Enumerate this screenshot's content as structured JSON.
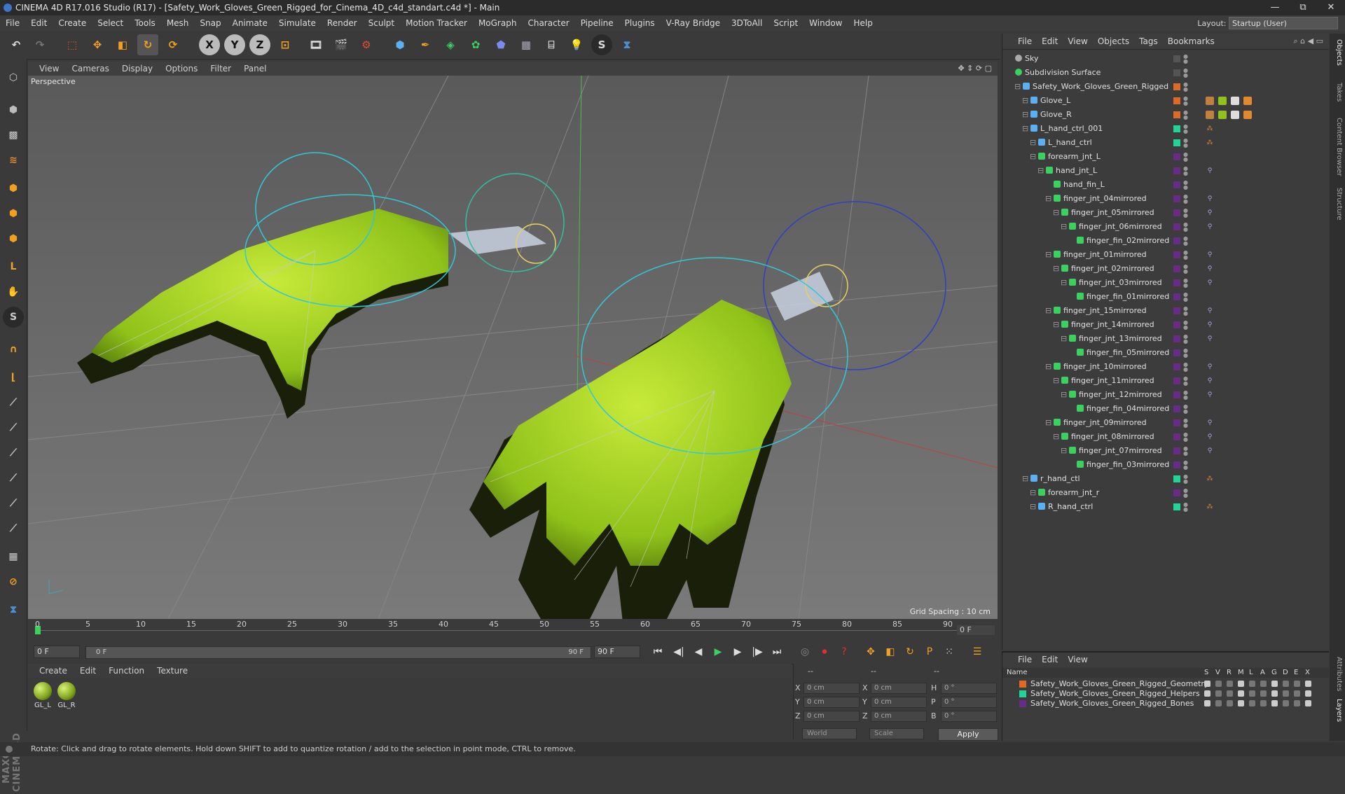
{
  "window": {
    "title": "CINEMA 4D R17.016 Studio (R17) - [Safety_Work_Gloves_Green_Rigged_for_Cinema_4D_c4d_standart.c4d *] - Main",
    "minimize": "—",
    "restore": "⧉",
    "close": "✕"
  },
  "menubar": {
    "items": [
      "File",
      "Edit",
      "Create",
      "Select",
      "Tools",
      "Mesh",
      "Snap",
      "Animate",
      "Simulate",
      "Render",
      "Sculpt",
      "Motion Tracker",
      "MoGraph",
      "Character",
      "Pipeline",
      "Plugins",
      "V-Ray Bridge",
      "3DToAll",
      "Script",
      "Window",
      "Help"
    ],
    "layout_label": "Layout:",
    "layout_value": "Startup (User)"
  },
  "toolbar": {
    "x_axis": "X",
    "y_axis": "Y",
    "z_axis": "Z"
  },
  "viewport": {
    "menu": [
      "View",
      "Cameras",
      "Display",
      "Options",
      "Filter",
      "Panel"
    ],
    "label": "Perspective",
    "grid_spacing": "Grid Spacing : 10 cm"
  },
  "timeline": {
    "ticks": [
      "0",
      "5",
      "10",
      "15",
      "20",
      "25",
      "30",
      "35",
      "40",
      "45",
      "50",
      "55",
      "60",
      "65",
      "70",
      "75",
      "80",
      "85",
      "90"
    ],
    "frame_end_display": "0 F",
    "current_frame": "0 F",
    "range_start": "0 F",
    "range_end": "90 F",
    "range_end_field": "90 F"
  },
  "materials": {
    "menu": [
      "Create",
      "Edit",
      "Function",
      "Texture"
    ],
    "items": [
      {
        "label": "GL_L"
      },
      {
        "label": "GL_R"
      }
    ]
  },
  "coords": {
    "header_left": "--",
    "header_mid": "--",
    "header_right": "--",
    "rows": [
      {
        "axis": "X",
        "pos": "0 cm",
        "axis2": "X",
        "size": "0 cm",
        "rot_label": "H",
        "rot": "0 °"
      },
      {
        "axis": "Y",
        "pos": "0 cm",
        "axis2": "Y",
        "size": "0 cm",
        "rot_label": "P",
        "rot": "0 °"
      },
      {
        "axis": "Z",
        "pos": "0 cm",
        "axis2": "Z",
        "size": "0 cm",
        "rot_label": "B",
        "rot": "0 °"
      }
    ],
    "mode": "World",
    "scale": "Scale",
    "apply": "Apply"
  },
  "objects": {
    "menu": [
      "File",
      "Edit",
      "View",
      "Objects",
      "Tags",
      "Bookmarks"
    ],
    "rows": [
      {
        "name": "Sky",
        "indent": 0,
        "color": "",
        "tags": ""
      },
      {
        "name": "Subdivision Surface",
        "indent": 0,
        "color": "",
        "tags": ""
      },
      {
        "name": "Safety_Work_Gloves_Green_Rigged",
        "indent": 1,
        "color": "#e06a24",
        "tags": ""
      },
      {
        "name": "Glove_L",
        "indent": 2,
        "color": "#e06a24",
        "tags": "mat"
      },
      {
        "name": "Glove_R",
        "indent": 2,
        "color": "#e06a24",
        "tags": "mat"
      },
      {
        "name": "L_hand_ctrl_001",
        "indent": 2,
        "color": "#22d39a",
        "tags": "ctrl"
      },
      {
        "name": "L_hand_ctrl",
        "indent": 3,
        "color": "#22d39a",
        "tags": "ctrl"
      },
      {
        "name": "forearm_jnt_L",
        "indent": 3,
        "color": "#6a2a8a",
        "tags": ""
      },
      {
        "name": "hand_jnt_L",
        "indent": 4,
        "color": "#6a2a8a",
        "tags": "ik"
      },
      {
        "name": "hand_fin_L",
        "indent": 5,
        "color": "#6a2a8a",
        "tags": ""
      },
      {
        "name": "finger_jnt_04mirrored",
        "indent": 5,
        "color": "#6a2a8a",
        "tags": "ik"
      },
      {
        "name": "finger_jnt_05mirrored",
        "indent": 6,
        "color": "#6a2a8a",
        "tags": "ik"
      },
      {
        "name": "finger_jnt_06mirrored",
        "indent": 7,
        "color": "#6a2a8a",
        "tags": "ik"
      },
      {
        "name": "finger_fin_02mirrored",
        "indent": 8,
        "color": "#6a2a8a",
        "tags": ""
      },
      {
        "name": "finger_jnt_01mirrored",
        "indent": 5,
        "color": "#6a2a8a",
        "tags": "ik"
      },
      {
        "name": "finger_jnt_02mirrored",
        "indent": 6,
        "color": "#6a2a8a",
        "tags": "ik"
      },
      {
        "name": "finger_jnt_03mirrored",
        "indent": 7,
        "color": "#6a2a8a",
        "tags": "ik"
      },
      {
        "name": "finger_fin_01mirrored",
        "indent": 8,
        "color": "#6a2a8a",
        "tags": ""
      },
      {
        "name": "finger_jnt_15mirrored",
        "indent": 5,
        "color": "#6a2a8a",
        "tags": "ik"
      },
      {
        "name": "finger_jnt_14mirrored",
        "indent": 6,
        "color": "#6a2a8a",
        "tags": "ik"
      },
      {
        "name": "finger_jnt_13mirrored",
        "indent": 7,
        "color": "#6a2a8a",
        "tags": "ik"
      },
      {
        "name": "finger_fin_05mirrored",
        "indent": 8,
        "color": "#6a2a8a",
        "tags": ""
      },
      {
        "name": "finger_jnt_10mirrored",
        "indent": 5,
        "color": "#6a2a8a",
        "tags": "ik"
      },
      {
        "name": "finger_jnt_11mirrored",
        "indent": 6,
        "color": "#6a2a8a",
        "tags": "ik"
      },
      {
        "name": "finger_jnt_12mirrored",
        "indent": 7,
        "color": "#6a2a8a",
        "tags": "ik"
      },
      {
        "name": "finger_fin_04mirrored",
        "indent": 8,
        "color": "#6a2a8a",
        "tags": ""
      },
      {
        "name": "finger_jnt_09mirrored",
        "indent": 5,
        "color": "#6a2a8a",
        "tags": "ik"
      },
      {
        "name": "finger_jnt_08mirrored",
        "indent": 6,
        "color": "#6a2a8a",
        "tags": "ik"
      },
      {
        "name": "finger_jnt_07mirrored",
        "indent": 7,
        "color": "#6a2a8a",
        "tags": "ik"
      },
      {
        "name": "finger_fin_03mirrored",
        "indent": 8,
        "color": "#6a2a8a",
        "tags": ""
      },
      {
        "name": "r_hand_ctl",
        "indent": 2,
        "color": "#22d39a",
        "tags": "ctrl"
      },
      {
        "name": "forearm_jnt_r",
        "indent": 3,
        "color": "#6a2a8a",
        "tags": ""
      },
      {
        "name": "R_hand_ctrl",
        "indent": 3,
        "color": "#22d39a",
        "tags": "ctrl"
      }
    ]
  },
  "side_tabs": [
    "Objects",
    "Takes",
    "Content Browser",
    "Structure"
  ],
  "side_tabs_lower": [
    "Attributes",
    "Layers"
  ],
  "layers": {
    "menu": [
      "File",
      "Edit",
      "View"
    ],
    "header_name": "Name",
    "header_cols": [
      "S",
      "V",
      "R",
      "M",
      "L",
      "A",
      "G",
      "D",
      "E",
      "X"
    ],
    "rows": [
      {
        "name": "Safety_Work_Gloves_Green_Rigged_Geometry",
        "color": "#e06a24"
      },
      {
        "name": "Safety_Work_Gloves_Green_Rigged_Helpers",
        "color": "#22d39a"
      },
      {
        "name": "Safety_Work_Gloves_Green_Rigged_Bones",
        "color": "#6a2a8a"
      }
    ]
  },
  "status": "Rotate: Click and drag to rotate elements. Hold down SHIFT to add to quantize rotation / add to the selection in point mode, CTRL to remove."
}
